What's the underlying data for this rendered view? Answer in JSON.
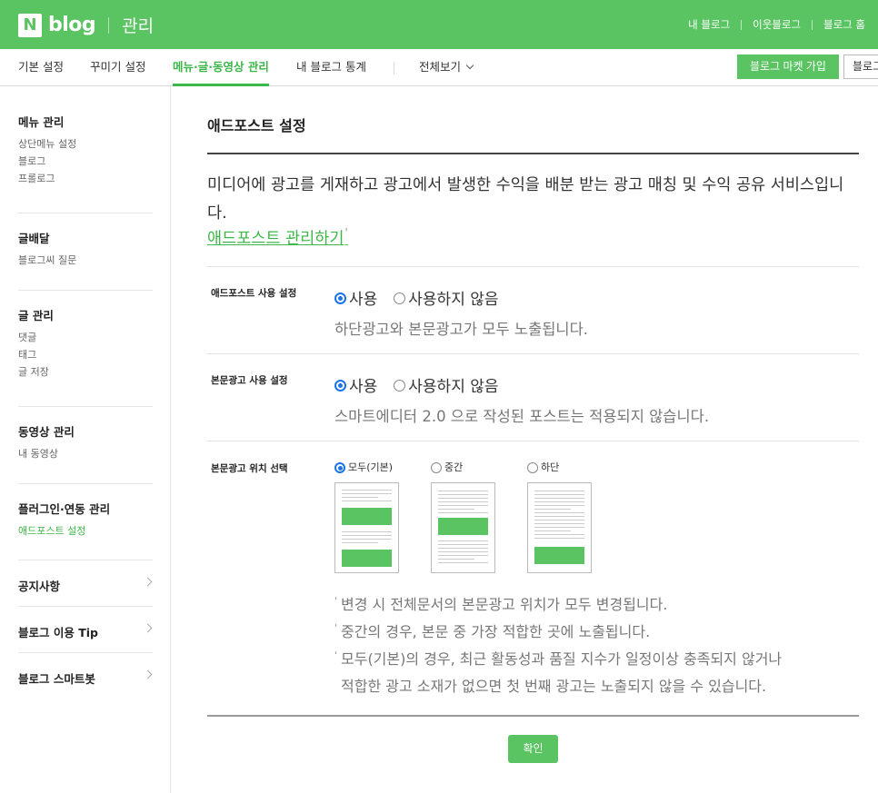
{
  "header": {
    "logo_n": "N",
    "logo_blog": "blog",
    "logo_admin": "관리",
    "links": [
      "내 블로그",
      "이웃블로그",
      "블로그 홈"
    ]
  },
  "subnav": {
    "tabs": [
      "기본 설정",
      "꾸미기 설정",
      "메뉴·글·동영상 관리",
      "내 블로그 통계",
      "전체보기"
    ],
    "active_tab": "메뉴·글·동영상 관리",
    "market_button": "블로그 마켓 가입",
    "blog_button": "블로그"
  },
  "sidebar": {
    "groups": [
      {
        "title": "메뉴 관리",
        "items": [
          "상단메뉴 설정",
          "블로그",
          "프롤로그"
        ]
      },
      {
        "title": "글배달",
        "items": [
          "블로그씨 질문"
        ]
      },
      {
        "title": "글 관리",
        "items": [
          "댓글",
          "태그",
          "글 저장"
        ]
      },
      {
        "title": "동영상 관리",
        "items": [
          "내 동영상"
        ]
      },
      {
        "title": "플러그인·연동 관리",
        "items": [
          "애드포스트 설정"
        ]
      }
    ],
    "active_item": "애드포스트 설정",
    "links": [
      "공지사항",
      "블로그 이용 Tip",
      "블로그 스마트봇"
    ]
  },
  "main": {
    "title": "애드포스트 설정",
    "description": "미디어에 광고를 게재하고 광고에서 발생한 수익을 배분 받는 광고 매칭 및 수익 공유 서비스입니다.",
    "manage_link": "애드포스트 관리하기",
    "settings": [
      {
        "label": "애드포스트 사용 설정",
        "options": [
          "사용",
          "사용하지 않음"
        ],
        "selected": "사용",
        "note": "하단광고와 본문광고가 모두 노출됩니다."
      },
      {
        "label": "본문광고 사용 설정",
        "options": [
          "사용",
          "사용하지 않음"
        ],
        "selected": "사용",
        "note": "스마트에디터 2.0 으로 작성된 포스트는 적용되지 않습니다."
      }
    ],
    "position": {
      "label": "본문광고 위치 선택",
      "options": [
        "모두(기본)",
        "중간",
        "하단"
      ],
      "selected": "모두(기본)"
    },
    "notes": [
      "변경 시 전체문서의 본문광고 위치가 모두 변경됩니다.",
      "중간의 경우, 본문 중 가장 적합한 곳에 노출됩니다.",
      "모두(기본)의 경우, 최근 활동성과 품질 지수가 일정이상 충족되지 않거나",
      "적합한 광고 소재가 없으면 첫 번째 광고는 노출되지 않을 수 있습니다."
    ],
    "confirm_button": "확인"
  },
  "colors": {
    "brand_green": "#5ac463",
    "active_green": "#3db74a",
    "radio_blue": "#1a73e8"
  }
}
